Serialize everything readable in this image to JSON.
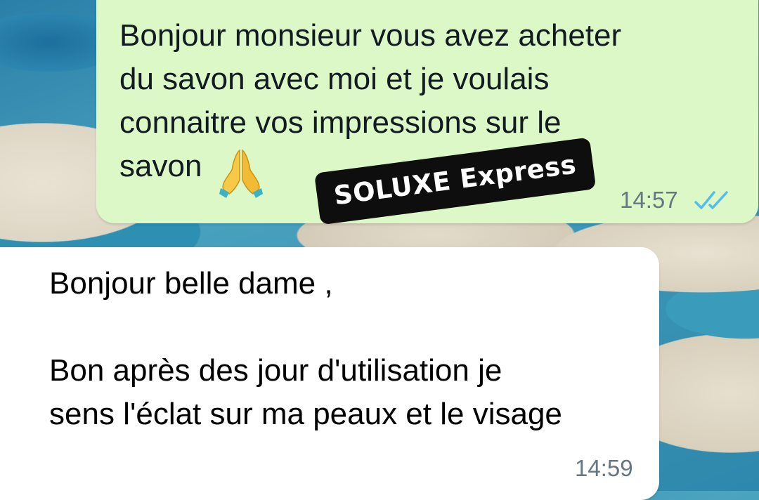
{
  "chat": {
    "outgoing": {
      "text": "Bonjour monsieur vous avez acheter\ndu savon avec moi et je voulais\nconnaitre vos impressions sur le\nsavon",
      "emoji": "folded-hands-icon",
      "time": "14:57",
      "status": "read-double-check-icon",
      "bubble_color": "#dcf8c6"
    },
    "incoming": {
      "greeting": "Bonjour belle dame ,",
      "body": "Bon après des jour d'utilisation je\nsens l'éclat sur ma peaux et le visage",
      "time": "14:59",
      "bubble_color": "#ffffff"
    }
  },
  "watermark": {
    "label": "SOLUXE Express"
  },
  "colors": {
    "timestamp": "#667781",
    "read_ticks": "#53bdeb"
  }
}
